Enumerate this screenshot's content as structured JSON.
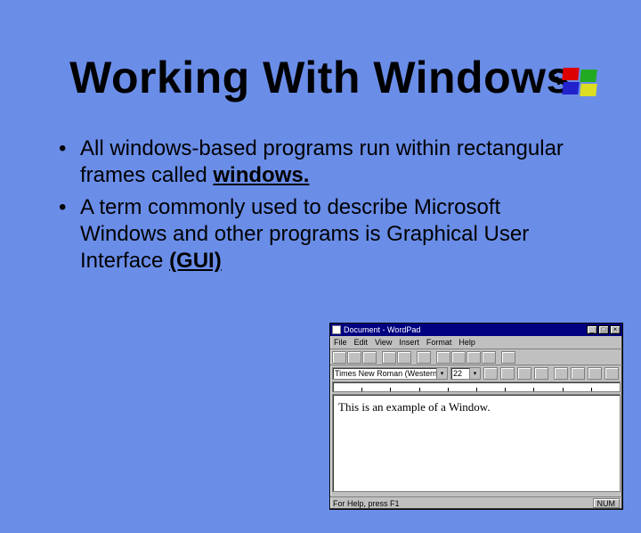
{
  "slide": {
    "title": "Working With Windows",
    "bullets": [
      {
        "pre": "All windows-based programs run within rectangular frames called ",
        "u": "windows."
      },
      {
        "pre": "A term commonly used to describe Microsoft Windows and other programs is Graphical User Interface ",
        "u": "(GUI)"
      }
    ]
  },
  "logo": {
    "name": "windows-logo-icon"
  },
  "wordpad": {
    "title": "Document - WordPad",
    "menus": [
      "File",
      "Edit",
      "View",
      "Insert",
      "Format",
      "Help"
    ],
    "font_name": "Times New Roman (Western)",
    "font_size": "22",
    "document_text": "This is an example of a Window.",
    "status_left": "For Help, press F1",
    "status_right": "NUM"
  }
}
